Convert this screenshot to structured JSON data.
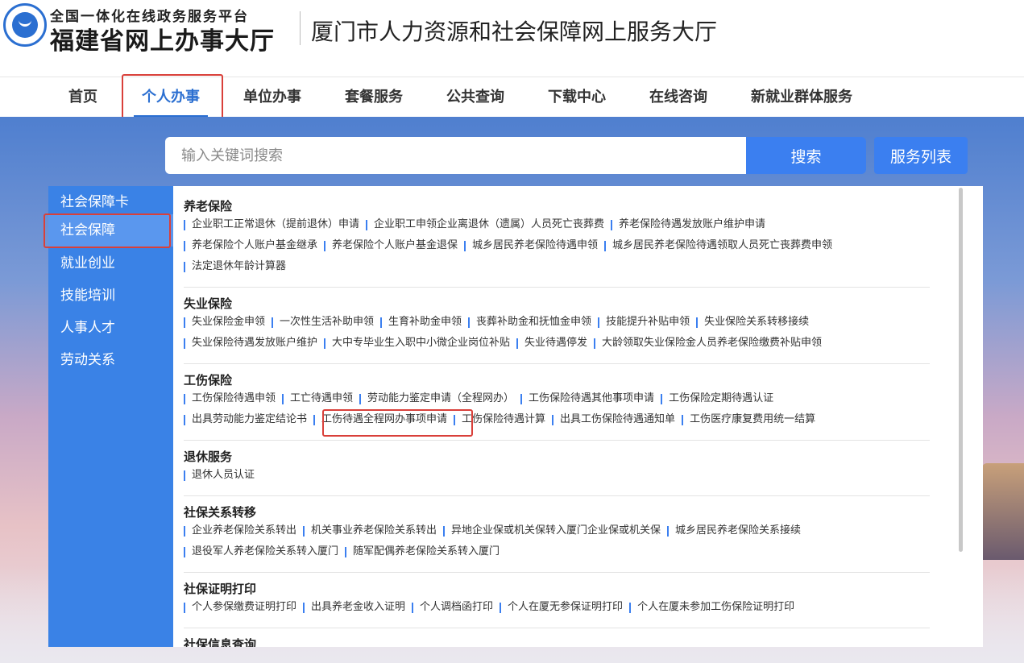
{
  "header": {
    "platform_line": "全国一体化在线政务服务平台",
    "platform_name": "福建省网上办事大厅",
    "site_title": "厦门市人力资源和社会保障网上服务大厅"
  },
  "nav": {
    "items": [
      {
        "label": "首页"
      },
      {
        "label": "个人办事",
        "active": true
      },
      {
        "label": "单位办事"
      },
      {
        "label": "套餐服务"
      },
      {
        "label": "公共查询"
      },
      {
        "label": "下载中心"
      },
      {
        "label": "在线咨询"
      },
      {
        "label": "新就业群体服务"
      }
    ]
  },
  "search": {
    "placeholder": "输入关键词搜索",
    "search_label": "搜索",
    "list_label": "服务列表"
  },
  "sidebar": {
    "items": [
      {
        "label": "社会保障卡"
      },
      {
        "label": "社会保障",
        "active": true
      },
      {
        "label": "就业创业"
      },
      {
        "label": "技能培训"
      },
      {
        "label": "人事人才"
      },
      {
        "label": "劳动关系"
      }
    ]
  },
  "sections": [
    {
      "title": "养老保险",
      "rows": [
        [
          "企业职工正常退休（提前退休）申请",
          "企业职工申领企业离退休（遗属）人员死亡丧葬费",
          "养老保险待遇发放账户维护申请"
        ],
        [
          "养老保险个人账户基金继承",
          "养老保险个人账户基金退保",
          "城乡居民养老保险待遇申领",
          "城乡居民养老保险待遇领取人员死亡丧葬费申领"
        ],
        [
          "法定退休年龄计算器"
        ]
      ]
    },
    {
      "title": "失业保险",
      "rows": [
        [
          "失业保险金申领",
          "一次性生活补助申领",
          "生育补助金申领",
          "丧葬补助金和抚恤金申领",
          "技能提升补贴申领",
          "失业保险关系转移接续"
        ],
        [
          "失业保险待遇发放账户维护",
          "大中专毕业生入职中小微企业岗位补贴",
          "失业待遇停发",
          "大龄领取失业保险金人员养老保险缴费补贴申领"
        ]
      ]
    },
    {
      "title": "工伤保险",
      "rows": [
        [
          "工伤保险待遇申领",
          "工亡待遇申领",
          "劳动能力鉴定申请（全程网办）",
          "工伤保险待遇其他事项申请",
          "工伤保险定期待遇认证"
        ],
        [
          "出具劳动能力鉴定结论书",
          "工伤待遇全程网办事项申请",
          "工伤保险待遇计算",
          "出具工伤保险待遇通知单",
          "工伤医疗康复费用统一结算"
        ]
      ]
    },
    {
      "title": "退休服务",
      "rows": [
        [
          "退休人员认证"
        ]
      ]
    },
    {
      "title": "社保关系转移",
      "rows": [
        [
          "企业养老保险关系转出",
          "机关事业养老保险关系转出",
          "异地企业保或机关保转入厦门企业保或机关保",
          "城乡居民养老保险关系接续"
        ],
        [
          "退役军人养老保险关系转入厦门",
          "随军配偶养老保险关系转入厦门"
        ]
      ]
    },
    {
      "title": "社保证明打印",
      "rows": [
        [
          "个人参保缴费证明打印",
          "出具养老金收入证明",
          "个人调档函打印",
          "个人在厦无参保证明打印",
          "个人在厦未参加工伤保险证明打印"
        ]
      ]
    },
    {
      "title": "社保信息查询",
      "rows": []
    }
  ]
}
